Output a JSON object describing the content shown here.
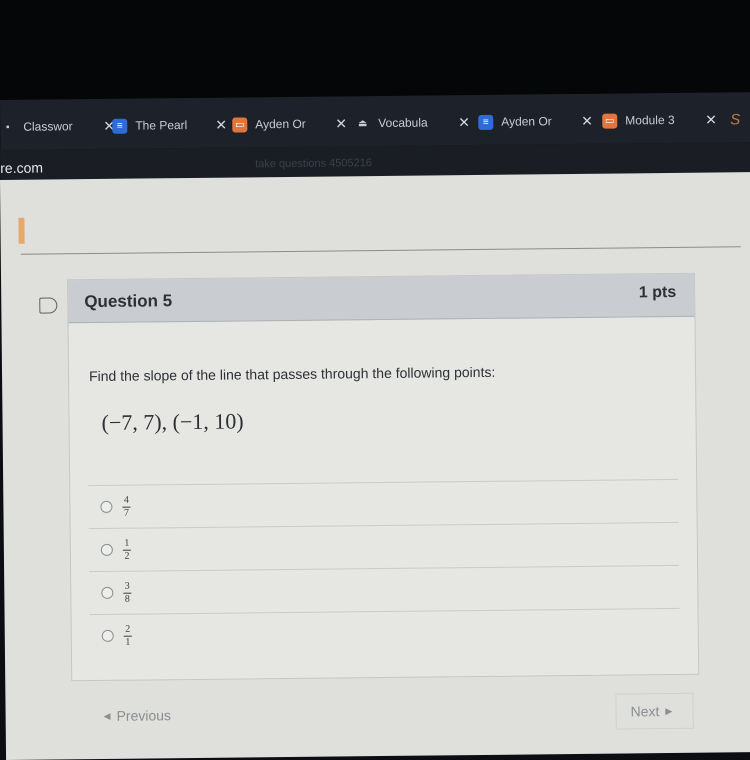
{
  "browser": {
    "tabs": [
      {
        "label": "Classwor",
        "icon": "classroom-icon"
      },
      {
        "label": "The Pearl",
        "icon": "docs-icon"
      },
      {
        "label": "Ayden Or",
        "icon": "slides-icon"
      },
      {
        "label": "Vocabula",
        "icon": "person-icon"
      },
      {
        "label": "Ayden Or",
        "icon": "docs-icon"
      },
      {
        "label": "Module 3",
        "icon": "slides-icon"
      }
    ],
    "extra_tab_glyph": "S",
    "close_glyph": "✕",
    "address": {
      "domain": "re.com",
      "path_fragment": "take questions 4505216"
    }
  },
  "quiz": {
    "question_title": "Question 5",
    "points": "1 pts",
    "prompt": "Find the slope of the line that passes through the following points:",
    "points_expression": "(−7, 7), (−1, 10)",
    "answers": [
      {
        "numerator": "4",
        "denominator": "7",
        "selected": false
      },
      {
        "numerator": "1",
        "denominator": "2",
        "selected": false
      },
      {
        "numerator": "3",
        "denominator": "8",
        "selected": false
      },
      {
        "numerator": "2",
        "denominator": "1",
        "selected": false
      }
    ],
    "prev_label": "Previous",
    "next_label": "Next"
  },
  "colors": {
    "accent": "#e8a869",
    "header_bg": "#c9ccd0",
    "docs_blue": "#2f6ad9",
    "slides_orange": "#e2753e"
  }
}
